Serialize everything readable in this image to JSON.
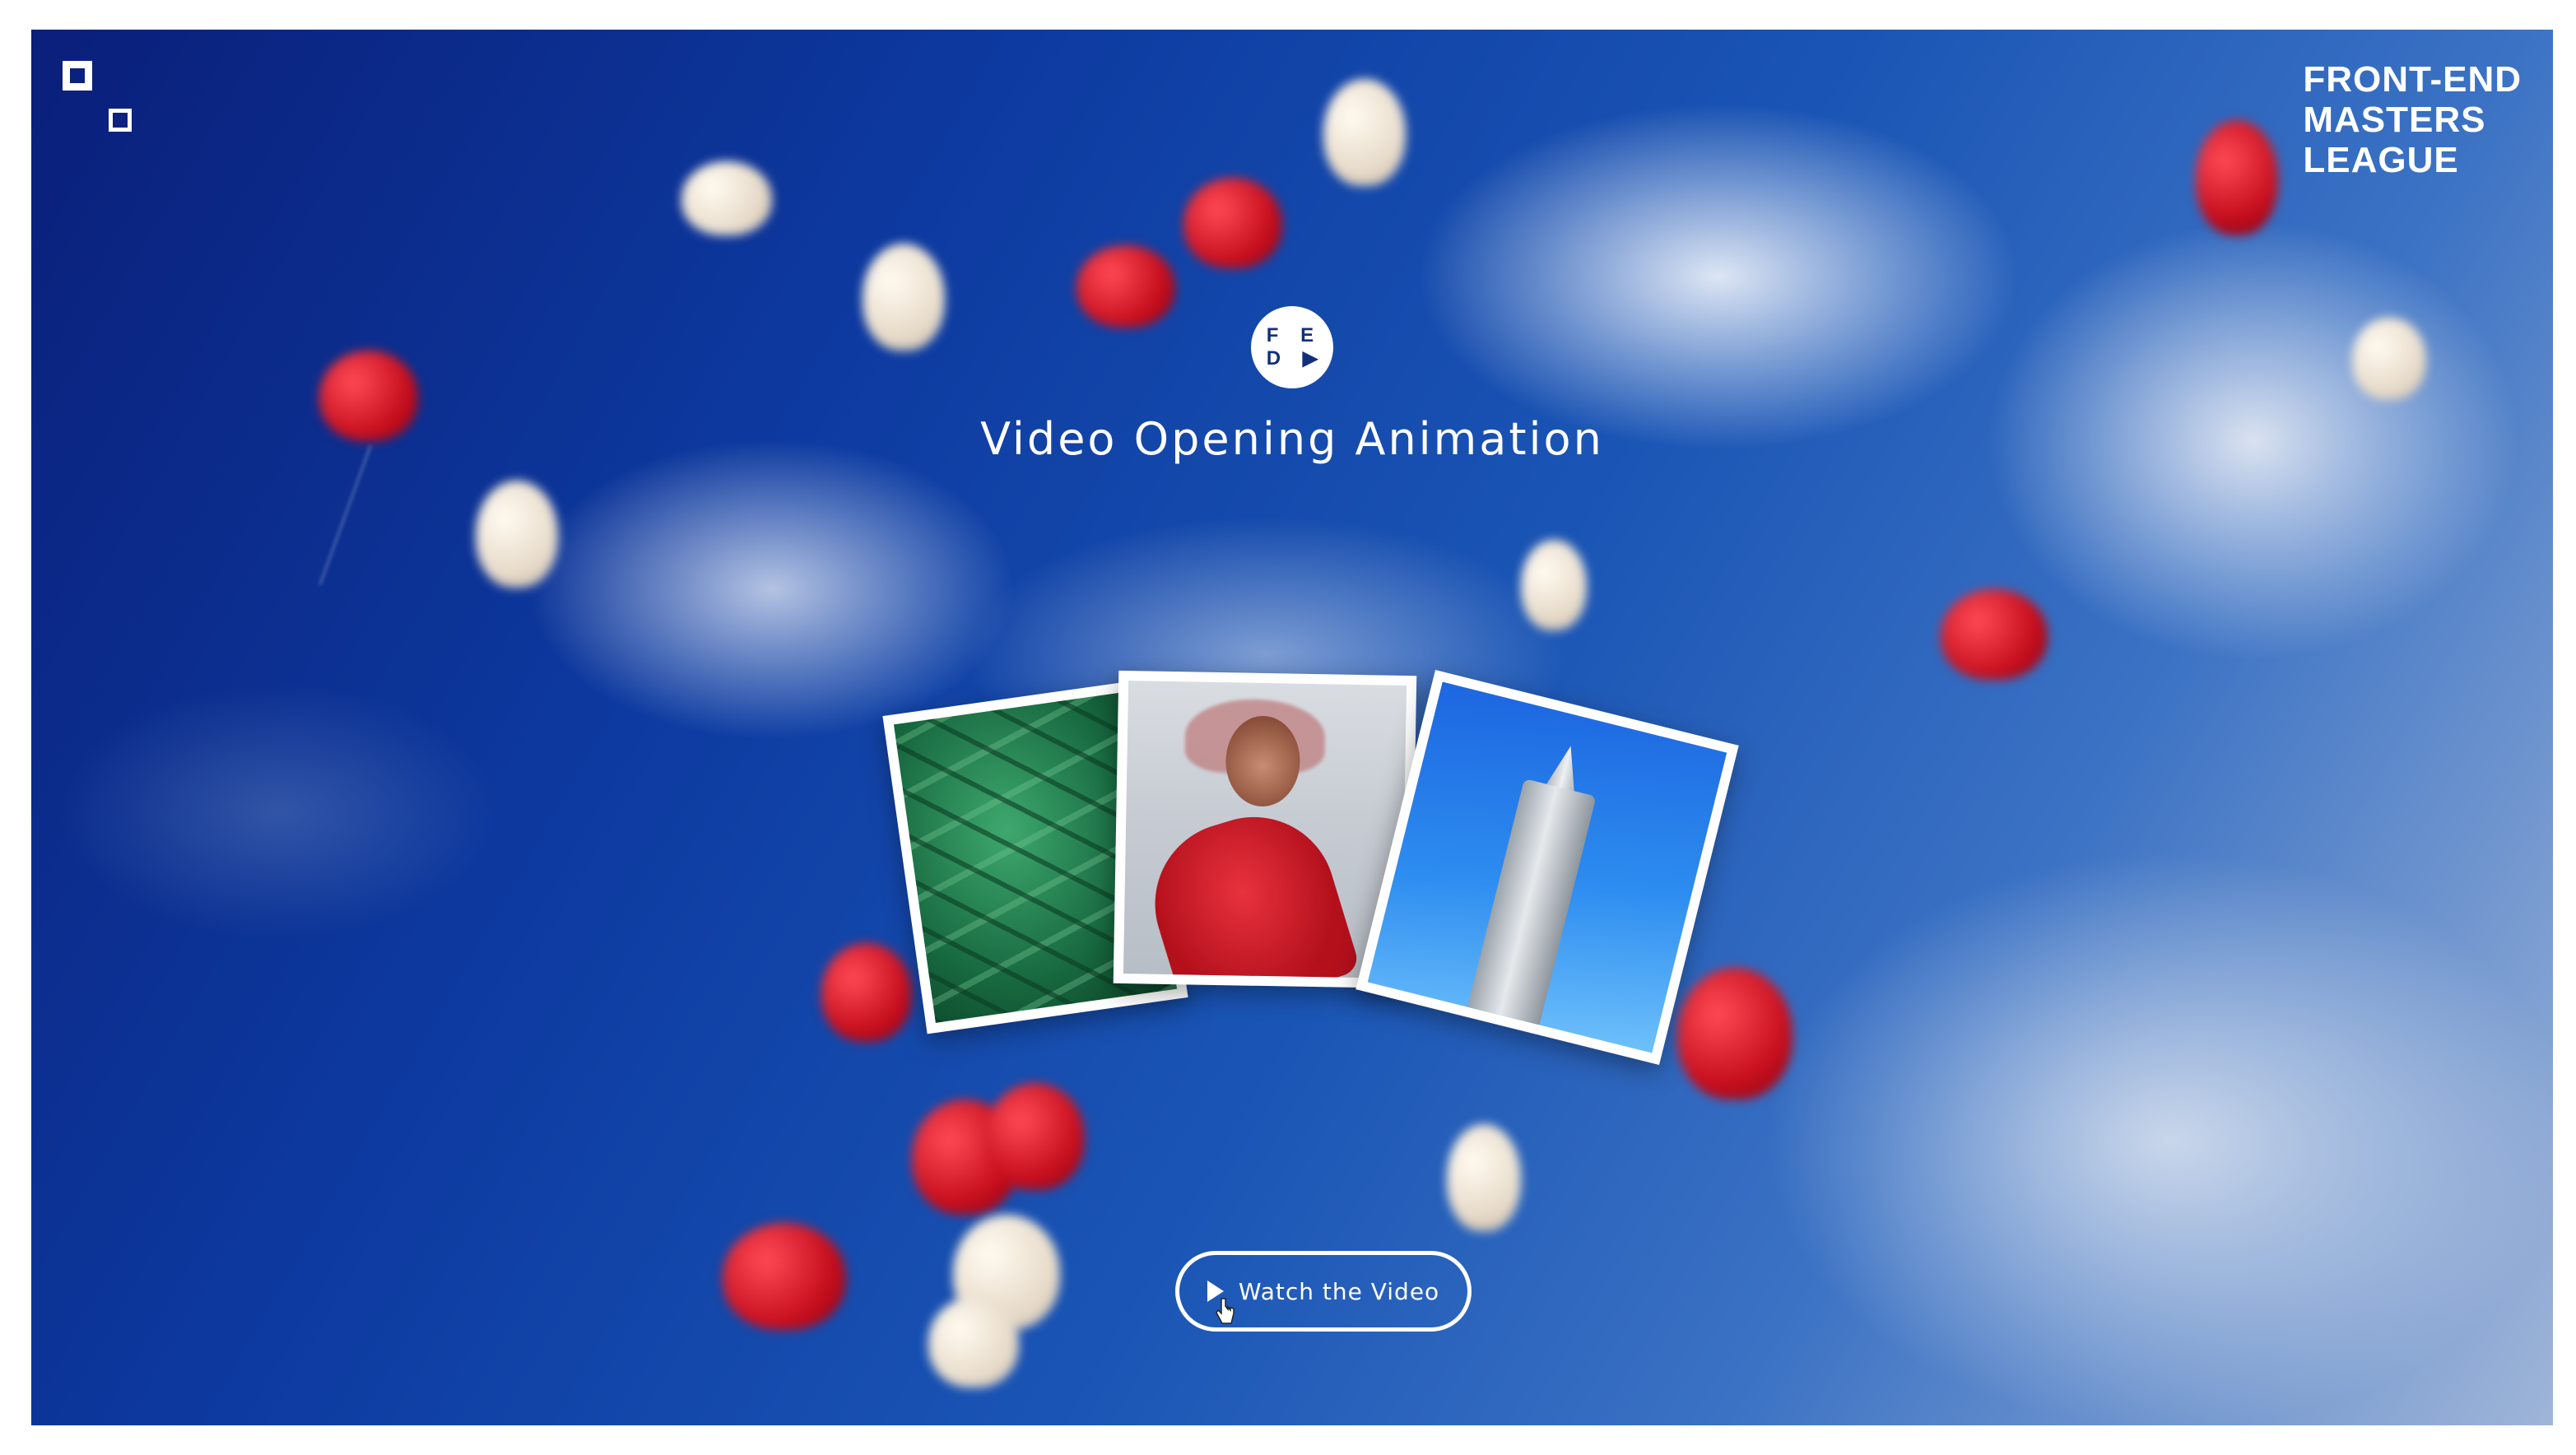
{
  "header": {
    "brand_lines": "FRONT-END\nMASTERS\nLEAGUE",
    "corner_logo_icon": "squares-logo-icon"
  },
  "badge": {
    "letters_line1": "F E",
    "letters_line2": "D ▶"
  },
  "hero": {
    "title": "Video Opening Animation"
  },
  "gallery": {
    "photos": [
      "leaves-photo",
      "woman-in-red-photo",
      "clock-tower-photo"
    ]
  },
  "cta": {
    "label": "Watch the Video",
    "icon": "play-icon"
  },
  "colors": {
    "sky_dark": "#0a1f7a",
    "sky_light": "#9fb5d8",
    "balloon_red": "#c8101f",
    "white": "#ffffff"
  }
}
